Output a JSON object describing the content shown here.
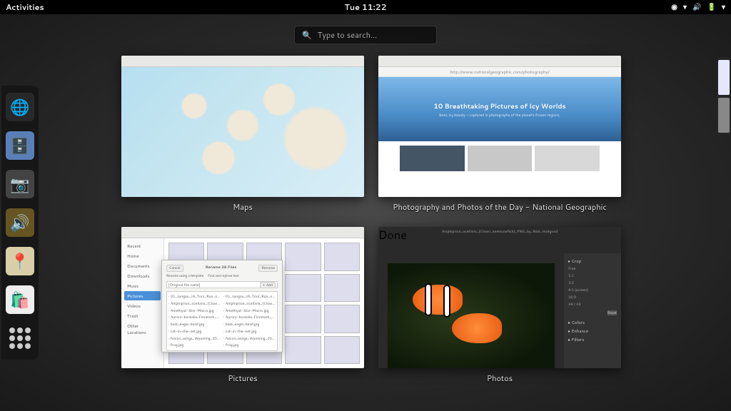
{
  "topbar": {
    "activities": "Activities",
    "clock": "Tue 11:22",
    "icons": [
      "universal-access",
      "wifi",
      "volume",
      "battery",
      "power"
    ]
  },
  "search": {
    "placeholder": "Type to search…"
  },
  "dock": {
    "items": [
      {
        "name": "web-browser",
        "glyph": "🌐"
      },
      {
        "name": "files",
        "glyph": "🗄️"
      },
      {
        "name": "camera",
        "glyph": "📷"
      },
      {
        "name": "music",
        "glyph": "🔊"
      },
      {
        "name": "maps",
        "glyph": "📍"
      },
      {
        "name": "software",
        "glyph": "🛍️"
      }
    ]
  },
  "windows": [
    {
      "title": "Maps"
    },
    {
      "title": "Photography and Photos of the Day - National Geographic",
      "url": "http://www.nationalgeographic.com/photography/",
      "hero_title": "10 Breathtaking Pictures of Icy Worlds",
      "hero_sub": "Bold, icy beauty — captured in photographs of the planet's frozen regions."
    },
    {
      "title": "Pictures",
      "sidebar": [
        "Recent",
        "Home",
        "Documents",
        "Downloads",
        "Music",
        "Pictures",
        "Videos",
        "Trash",
        "Other Locations"
      ],
      "selected": "Pictures",
      "dialog": {
        "title": "Rename 28 Files",
        "tabs": [
          "Rename using a template",
          "Find and replace text"
        ],
        "input_placeholder": "[Original file name]",
        "add_btn": "+ Add",
        "rows": [
          "01_Jungau_JA_Tors_Ron_oto…",
          "01_Jungau_JA_Tors_Ron_oto_thumb…",
          "Amphiprion_ocellaris_(Clown_anemonefish)…",
          "Amphiprion_ocellaris_(Clown_anemonefish)…",
          "Amethyst-Star-Macro.jpg",
          "Amethyst-Star-Macro.jpg",
          "Aurora-borealis_Finnmark_Norway.jpg",
          "Aurora-borealis_Finnmark_Norway.jpg",
          "bald_eagle_head.jpg",
          "bald_eagle_head.jpg",
          "cat-in-the-net.jpg",
          "cat-in-the-net.jpg",
          "falcon_wings_Wyoming_2013.jpg",
          "falcon_wings_Wyoming_2013.jpg",
          "frog.jpg",
          "frog.jpg"
        ],
        "cancel": "Cancel",
        "rename": "Rename"
      }
    },
    {
      "title": "Photos",
      "filename": "Amphiprion_ocellaris_(Clown_anemonefish)_PNG_by_Nick_Hobgood",
      "panel": {
        "crop": "Crop",
        "aspect": "Free",
        "aspects": [
          "Free",
          "1:1",
          "3:2",
          "4:3 (screen)",
          "16:9",
          "A4 / A3"
        ],
        "reset": "Reset",
        "colors": "Colors",
        "enhance": "Enhance",
        "filters": "Filters"
      },
      "done": "Done"
    }
  ]
}
